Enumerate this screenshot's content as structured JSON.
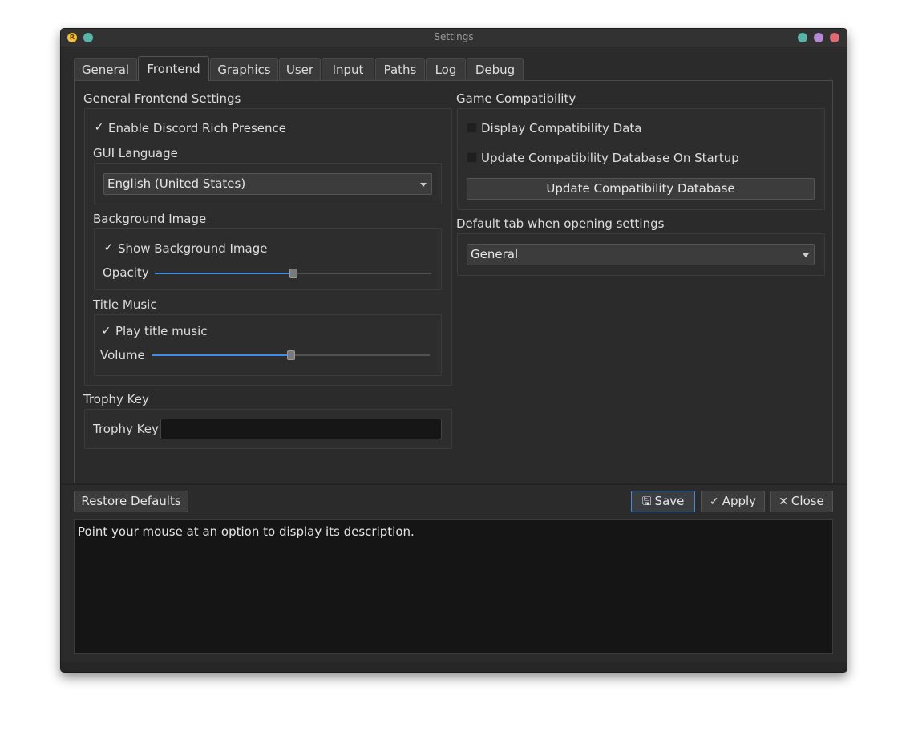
{
  "window": {
    "title": "Settings",
    "app_icon": "rpcs3-icon",
    "controls": [
      "minimize-icon",
      "maximize-icon",
      "close-icon"
    ]
  },
  "tabs": [
    {
      "label": "General",
      "active": false
    },
    {
      "label": "Frontend",
      "active": true
    },
    {
      "label": "Graphics",
      "active": false
    },
    {
      "label": "User",
      "active": false
    },
    {
      "label": "Input",
      "active": false
    },
    {
      "label": "Paths",
      "active": false
    },
    {
      "label": "Log",
      "active": false
    },
    {
      "label": "Debug",
      "active": false
    }
  ],
  "frontend": {
    "general_title": "General Frontend Settings",
    "discord_label": "Enable Discord Rich Presence",
    "discord_checked": true,
    "gui_language_title": "GUI Language",
    "gui_language_value": "English (United States)",
    "background_title": "Background Image",
    "show_background_label": "Show Background Image",
    "show_background_checked": true,
    "opacity_label": "Opacity",
    "opacity_value": 0.5,
    "title_music_title": "Title Music",
    "play_music_label": "Play title music",
    "play_music_checked": true,
    "volume_label": "Volume",
    "volume_value": 0.5,
    "trophy_title": "Trophy Key",
    "trophy_label": "Trophy Key",
    "trophy_value": "",
    "compat_title": "Game Compatibility",
    "display_compat_label": "Display Compatibility Data",
    "display_compat_checked": false,
    "update_compat_startup_label": "Update Compatibility Database On Startup",
    "update_compat_startup_checked": false,
    "update_compat_button": "Update Compatibility Database",
    "default_tab_title": "Default tab when opening settings",
    "default_tab_value": "General"
  },
  "footer": {
    "restore_defaults": "Restore Defaults",
    "save": "Save",
    "apply": "Apply",
    "close": "Close",
    "description": "Point your mouse at an option to display its description."
  },
  "colors": {
    "window_bg": "#2b2b2b",
    "accent": "#3d8ee6",
    "description_bg": "#151515"
  }
}
